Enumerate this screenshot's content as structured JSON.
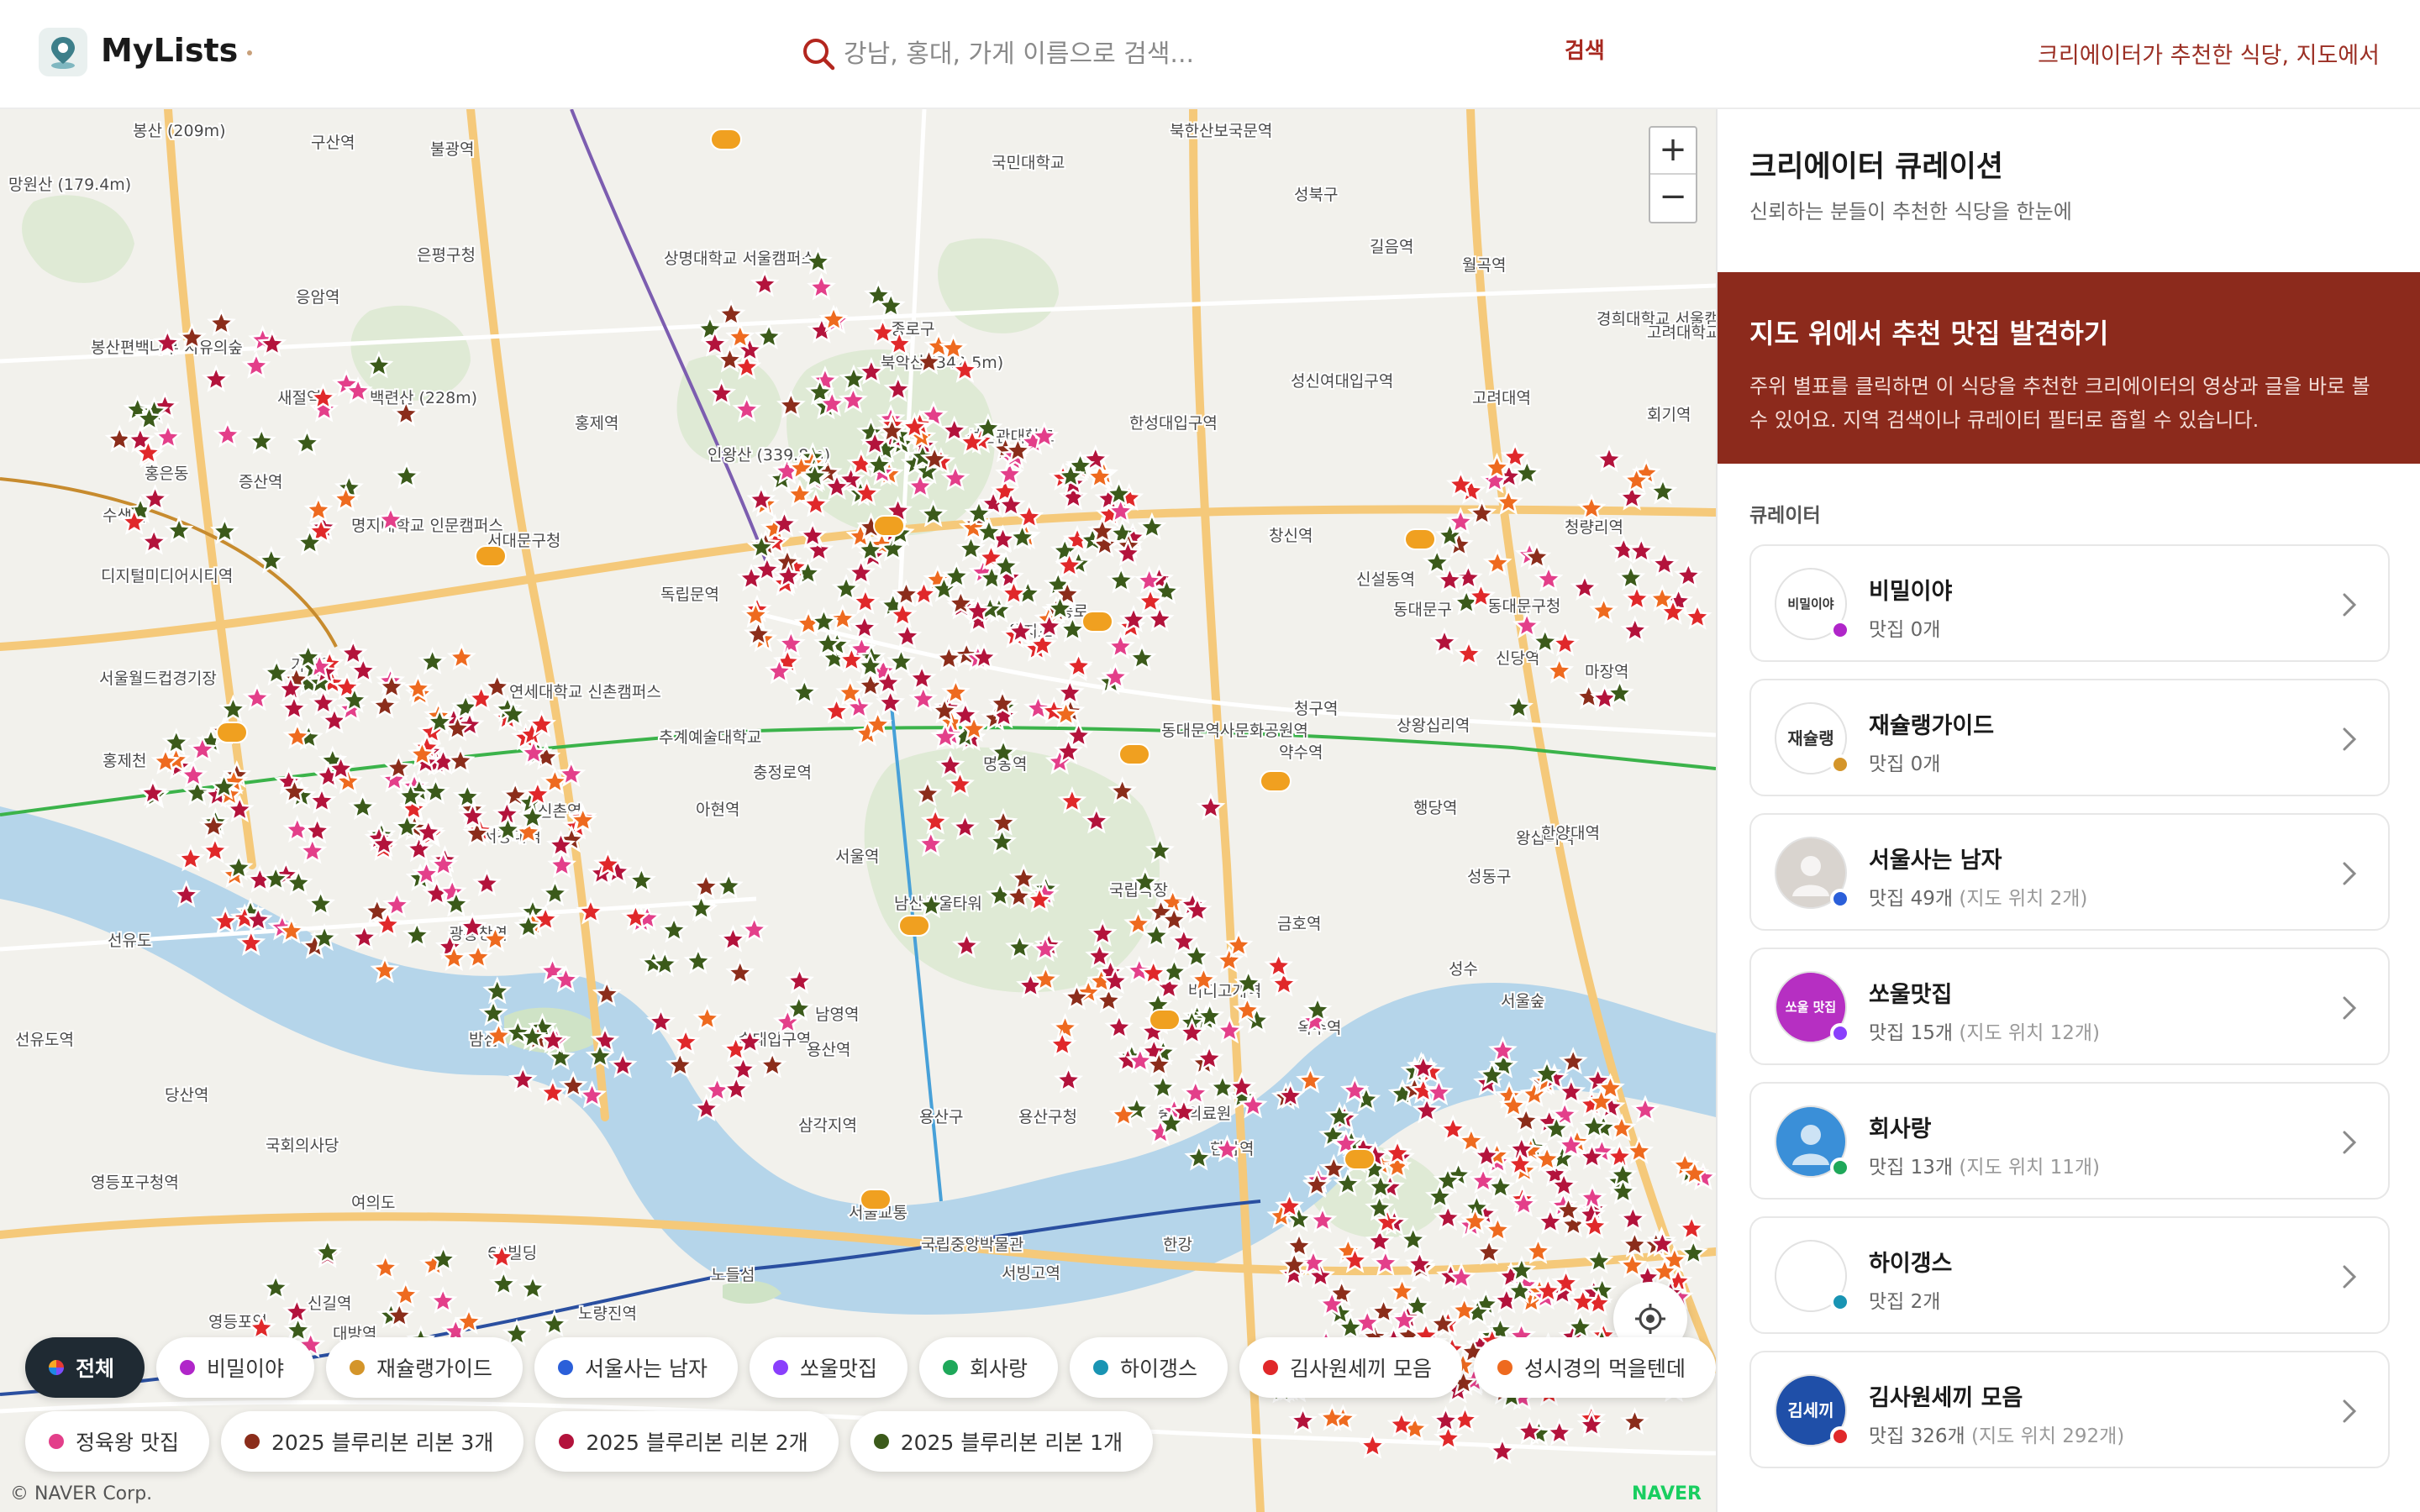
{
  "header": {
    "brand": "MyLists",
    "search_placeholder": "강남, 홍대, 가게 이름으로 검색...",
    "search_button": "검색",
    "tagline": "크리에이터가 추천한 식당, 지도에서"
  },
  "map": {
    "zoom_in": "+",
    "zoom_out": "−",
    "copyright": "© NAVER Corp.",
    "provider": "NAVER",
    "labels": [
      "봉산 (209m)",
      "구산역",
      "불광역",
      "망원산 (179.4m)",
      "은평구청",
      "응암역",
      "봉산편백나무 치유의숲",
      "새절역",
      "백련산 (228m)",
      "홍제역",
      "증산역",
      "수색역",
      "디지털미디어시티역",
      "명지대학교 인문캠퍼스",
      "서대문구청",
      "인왕산 (339.8m)",
      "독립문역",
      "가좌역",
      "서울월드컵경기장",
      "연세대학교 신촌캠퍼스",
      "추계예술대학교",
      "홍제천",
      "신촌역",
      "아현역",
      "충정로역",
      "서강대역",
      "광흥창역",
      "선유도",
      "밤섬",
      "서울역",
      "남산서울타워",
      "국립극장",
      "버티고개역",
      "용산구",
      "용산구청",
      "숙대입구역",
      "삼각지역",
      "국회의사당",
      "여의도",
      "63빌딩",
      "노들섬",
      "신길역",
      "대방역",
      "국립중앙박물관",
      "서빙고역",
      "한강",
      "옥수역",
      "한남역",
      "금호역",
      "성동구",
      "서울숲",
      "성수",
      "상명대학교 서울캠퍼스",
      "국민대학교",
      "북한산보국문역",
      "성북구",
      "길음역",
      "성신여대입구역",
      "한성대입구역",
      "창신역",
      "종로구",
      "북악산 (342.5m)",
      "성균관대학교",
      "신설동역",
      "동대문구청",
      "청량리역",
      "상왕십리역",
      "행당역",
      "왕십리역",
      "마장역",
      "한양대역",
      "경희대학교 서울캠퍼스",
      "고려대역",
      "회기역",
      "종로",
      "을지로",
      "동대문역사문화공원역",
      "명동역",
      "약수역",
      "청구역",
      "신당역",
      "노량진역",
      "영등포역",
      "선유도역",
      "당산역",
      "영등포구청역",
      "용산역",
      "남영역",
      "서울교통",
      "중앙의료원",
      "동대문구",
      "월곡역",
      "고려대학교",
      "홍은동"
    ]
  },
  "filters": {
    "rows": [
      [
        {
          "label": "전체",
          "color": "#333333",
          "active": true
        },
        {
          "label": "비밀이야",
          "color": "#b026c9"
        },
        {
          "label": "재슐랭가이드",
          "color": "#d4952a"
        },
        {
          "label": "서울사는 남자",
          "color": "#2b5fd9"
        },
        {
          "label": "쏘울맛집",
          "color": "#8a3ffc"
        },
        {
          "label": "회사랑",
          "color": "#1fa85a"
        },
        {
          "label": "하이갱스",
          "color": "#1994b3"
        },
        {
          "label": "김사원세끼 모음",
          "color": "#e0282a"
        },
        {
          "label": "성시경의 먹을텐데",
          "color": "#ee6a1f"
        }
      ],
      [
        {
          "label": "정육왕 맛집",
          "color": "#e33f8a"
        },
        {
          "label": "2025 블루리본 리본 3개",
          "color": "#8b2d1b"
        },
        {
          "label": "2025 블루리본 리본 2개",
          "color": "#b3133c"
        },
        {
          "label": "2025 블루리본 리본 1개",
          "color": "#3b5a1a"
        }
      ]
    ]
  },
  "panel": {
    "title": "크리에이터 큐레이션",
    "subtitle": "신뢰하는 분들이 추천한 식당을 한눈에",
    "banner_title": "지도 위에서 추천 맛집 발견하기",
    "banner_text": "주위 별표를 클릭하면 이 식당을 추천한 크리에이터의 영상과 글을 바로 볼 수 있어요. 지역 검색이나 큐레이터 필터로 좁힐 수 있습니다.",
    "section_label": "큐레이터",
    "curators": [
      {
        "name": "비밀이야",
        "count": "맛집 0개",
        "location": "",
        "badge": "#b026c9",
        "avatar_bg": "#ffffff",
        "avatar_text": "비밀이야"
      },
      {
        "name": "재슐랭가이드",
        "count": "맛집 0개",
        "location": "",
        "badge": "#d4952a",
        "avatar_bg": "#ffffff",
        "avatar_text": "재슐랭"
      },
      {
        "name": "서울사는 남자",
        "count": "맛집 49개",
        "location": "(지도 위치 2개)",
        "badge": "#2b5fd9",
        "avatar_bg": "#d9d4cf",
        "avatar_text": ""
      },
      {
        "name": "쏘울맛집",
        "count": "맛집 15개",
        "location": "(지도 위치 12개)",
        "badge": "#8a3ffc",
        "avatar_bg": "#b62fc2",
        "avatar_text": "쏘울 맛집"
      },
      {
        "name": "회사랑",
        "count": "맛집 13개",
        "location": "(지도 위치 11개)",
        "badge": "#1fa85a",
        "avatar_bg": "#3a8fd8",
        "avatar_text": ""
      },
      {
        "name": "하이갱스",
        "count": "맛집 2개",
        "location": "",
        "badge": "#1994b3",
        "avatar_bg": "#ffffff",
        "avatar_text": ""
      },
      {
        "name": "김사원세끼 모음",
        "count": "맛집 326개",
        "location": "(지도 위치 292개)",
        "badge": "#e0282a",
        "avatar_bg": "#1f4fa8",
        "avatar_text": "김세끼"
      }
    ]
  }
}
